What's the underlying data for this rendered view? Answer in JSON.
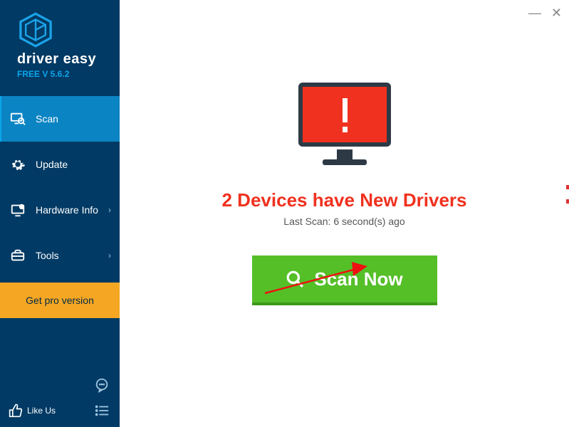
{
  "brand": {
    "name": "driver easy",
    "tagline": "FREE V 5.6.2"
  },
  "nav": {
    "scan": "Scan",
    "update": "Update",
    "hardware": "Hardware Info",
    "tools": "Tools"
  },
  "pro_button": "Get pro version",
  "like_us": "Like Us",
  "main": {
    "headline": "2 Devices have New Drivers",
    "subline": "Last Scan: 6 second(s) ago",
    "scan_button": "Scan Now"
  },
  "window": {
    "min": "—",
    "close": "✕"
  }
}
